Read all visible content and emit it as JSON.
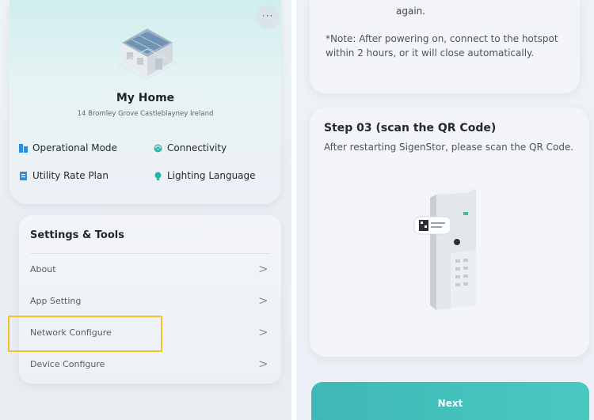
{
  "home": {
    "more_label": "···",
    "name": "My Home",
    "address": "14 Bromley Grove  Castleblayney Ireland",
    "features": [
      {
        "label": "Operational Mode",
        "icon": "operational-mode-icon"
      },
      {
        "label": "Connectivity",
        "icon": "connectivity-icon"
      },
      {
        "label": "Utility Rate Plan",
        "icon": "utility-rate-plan-icon"
      },
      {
        "label": "Lighting Language",
        "icon": "lighting-language-icon"
      }
    ]
  },
  "settings": {
    "title": "Settings & Tools",
    "items": [
      {
        "label": "About"
      },
      {
        "label": "App Setting"
      },
      {
        "label": "Network Configure",
        "highlighted": true
      },
      {
        "label": "Device Configure"
      }
    ],
    "chevron": ">"
  },
  "right": {
    "note_tail": "again.",
    "note": "*Note: After powering on, connect to the hotspot within 2 hours, or it will close automatically.",
    "step_title": "Step 03 (scan the QR Code)",
    "step_desc": "After restarting SigenStor, please scan the QR Code.",
    "next_label": "Next"
  },
  "colors": {
    "accent": "#44c0bb",
    "highlight": "#f3c02a",
    "icon_blue": "#2a8fd8",
    "icon_teal": "#29b3a6"
  }
}
